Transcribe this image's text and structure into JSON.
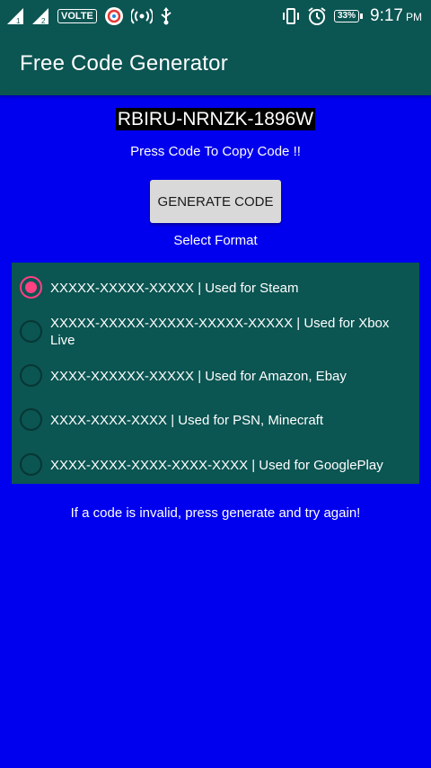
{
  "status_bar": {
    "volte": "VOLTE",
    "battery": "33%",
    "time": "9:17",
    "ampm": "PM"
  },
  "app": {
    "title": "Free Code Generator"
  },
  "code": {
    "value": "RBIRU-NRNZK-1896W",
    "hint": "Press Code To Copy Code !!"
  },
  "generate_button": {
    "label": "GENERATE CODE"
  },
  "format": {
    "label": "Select Format",
    "options": [
      {
        "label": "XXXXX-XXXXX-XXXXX | Used for Steam",
        "checked": true
      },
      {
        "label": "XXXXX-XXXXX-XXXXX-XXXXX-XXXXX | Used for Xbox Live",
        "checked": false
      },
      {
        "label": "XXXX-XXXXXX-XXXXX | Used for Amazon, Ebay",
        "checked": false
      },
      {
        "label": "XXXX-XXXX-XXXX | Used for PSN, Minecraft",
        "checked": false
      },
      {
        "label": "XXXX-XXXX-XXXX-XXXX-XXXX | Used for GooglePlay",
        "checked": false
      }
    ]
  },
  "footer": {
    "note": "If a code is invalid, press generate and try again!"
  },
  "colors": {
    "background": "#0000ee",
    "primary_dark": "#0b5552",
    "accent": "#ff4081"
  }
}
